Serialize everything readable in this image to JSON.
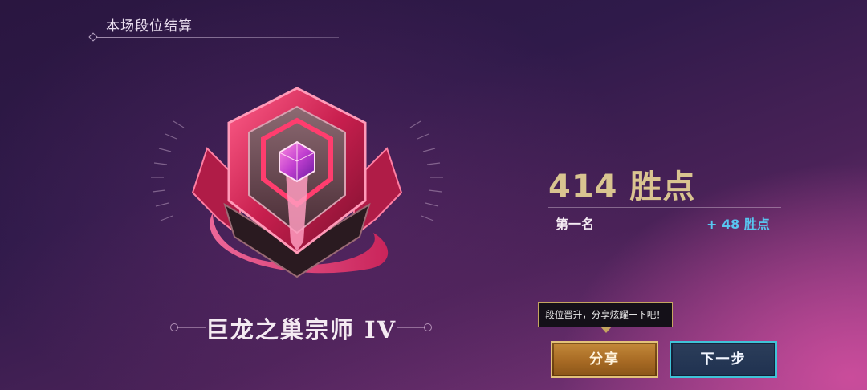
{
  "header": {
    "title": "本场段位结算"
  },
  "rank": {
    "name": "巨龙之巢宗师 IV",
    "icon": "grandmaster-rank-emblem-icon",
    "accent_color": "#e8356c"
  },
  "result": {
    "points": "414 胜点",
    "placement": "第一名",
    "gain": "+ 48 胜点",
    "gain_color": "#58c6f0"
  },
  "tooltip": {
    "text": "段位晋升，分享炫耀一下吧！"
  },
  "buttons": {
    "share_label": "分享",
    "next_label": "下一步"
  }
}
